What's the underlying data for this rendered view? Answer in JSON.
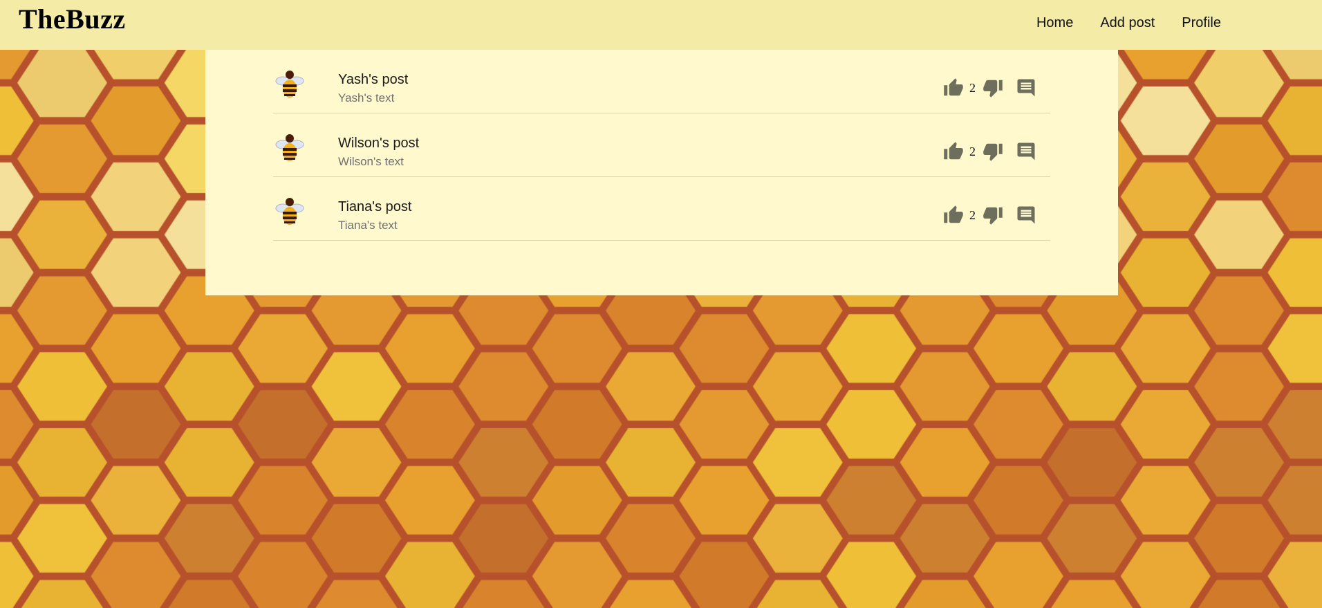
{
  "theme": {
    "nav_bg": "#f3eba6",
    "panel_bg": "#fff9cd",
    "icon_color": "#6e6e5c",
    "hex_border": "#b6512c"
  },
  "nav": {
    "brand": "TheBuzz",
    "links": [
      "Home",
      "Add post",
      "Profile"
    ]
  },
  "posts": [
    {
      "title": "Yash's post",
      "text": "Yash's text",
      "likes": "2",
      "avatar_icon": "bee-icon"
    },
    {
      "title": "Wilson's post",
      "text": "Wilson's text",
      "likes": "2",
      "avatar_icon": "bee-icon"
    },
    {
      "title": "Tiana's post",
      "text": "Tiana's text",
      "likes": "2",
      "avatar_icon": "bee-icon"
    }
  ],
  "action_icons": [
    "thumb-up-icon",
    "thumb-down-icon",
    "comment-icon"
  ]
}
